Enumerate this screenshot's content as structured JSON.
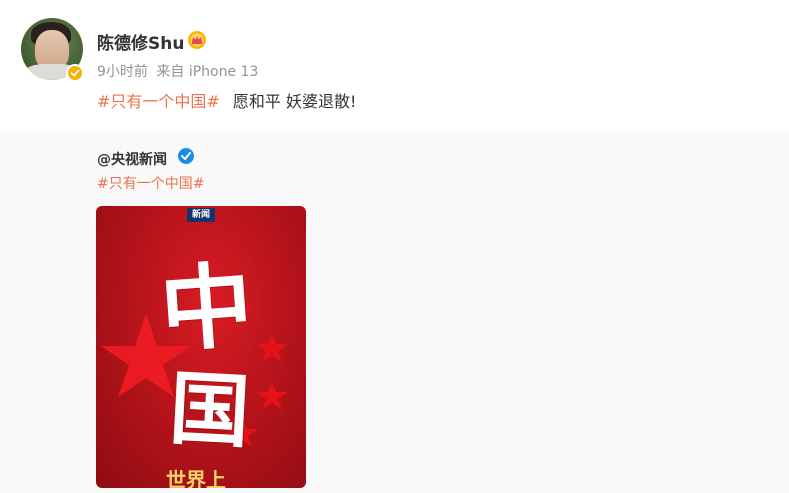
{
  "post": {
    "author": {
      "name": "陈德修Shu",
      "avatar_icon": "avatar-photo",
      "badge_icon": "crown-icon",
      "verify_icon": "yellow-verified-icon"
    },
    "meta": {
      "time": "9小时前",
      "source": "来自 iPhone 13"
    },
    "content": {
      "hashtag": "#只有一个中国#",
      "text": "愿和平 妖婆退散!"
    }
  },
  "repost": {
    "author": "@央视新闻",
    "verify_icon": "blue-verified-icon",
    "hashtag": "#只有一个中国#",
    "image": {
      "tag": "新闻",
      "title_line1": "中",
      "title_line2": "国",
      "bottom_text": "世界上"
    }
  },
  "colors": {
    "hashtag": "#eb7350",
    "background_repost": "#f9f9f9",
    "poster_red": "#c0141b"
  }
}
